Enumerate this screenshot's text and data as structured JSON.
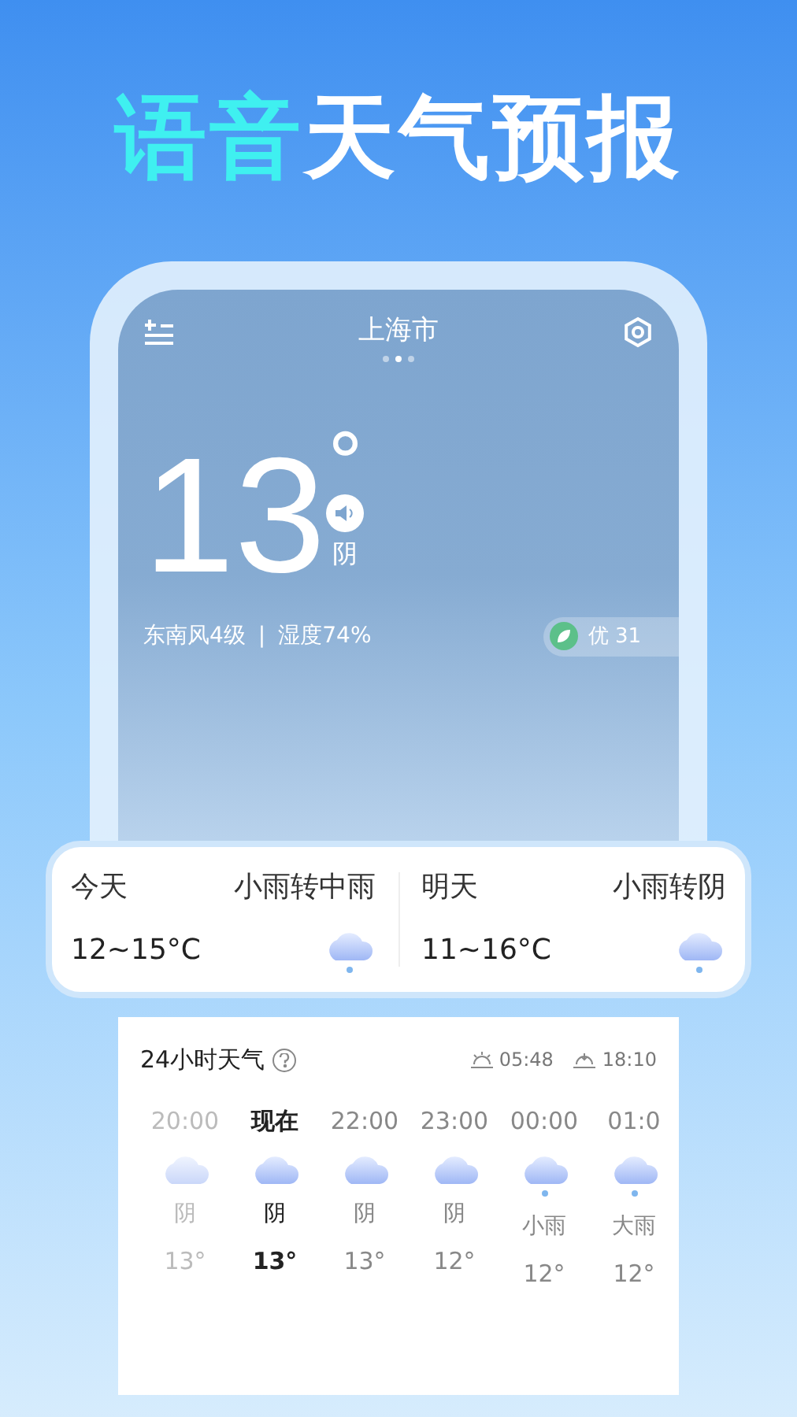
{
  "headline": {
    "accent": "语音",
    "rest": "天气预报"
  },
  "header": {
    "city": "上海市",
    "pages": [
      {
        "selected": false
      },
      {
        "selected": true
      },
      {
        "selected": false
      }
    ]
  },
  "current": {
    "temperature": "13",
    "degree": "°",
    "condition": "阴",
    "wind": "东南风4级",
    "separator": "|",
    "humidity": "湿度74%",
    "aqi": "优 31"
  },
  "forecast": [
    {
      "day": "今天",
      "condition": "小雨转中雨",
      "range": "12~15°C"
    },
    {
      "day": "明天",
      "condition": "小雨转阴",
      "range": "11~16°C"
    }
  ],
  "hourly": {
    "title": "24小时天气",
    "sunrise": "05:48",
    "sunset": "18:10",
    "hours": [
      {
        "time": "20:00",
        "kind": "past",
        "selected": false,
        "condition": "阴",
        "temp": "13°"
      },
      {
        "time": "现在",
        "kind": "cloud",
        "selected": true,
        "condition": "阴",
        "temp": "13°"
      },
      {
        "time": "22:00",
        "kind": "cloud",
        "selected": false,
        "condition": "阴",
        "temp": "13°"
      },
      {
        "time": "23:00",
        "kind": "cloud",
        "selected": false,
        "condition": "阴",
        "temp": "12°"
      },
      {
        "time": "00:00",
        "kind": "rain",
        "selected": false,
        "condition": "小雨",
        "temp": "12°"
      },
      {
        "time": "01:0",
        "kind": "rain",
        "selected": false,
        "condition": "大雨",
        "temp": "12°"
      }
    ]
  }
}
